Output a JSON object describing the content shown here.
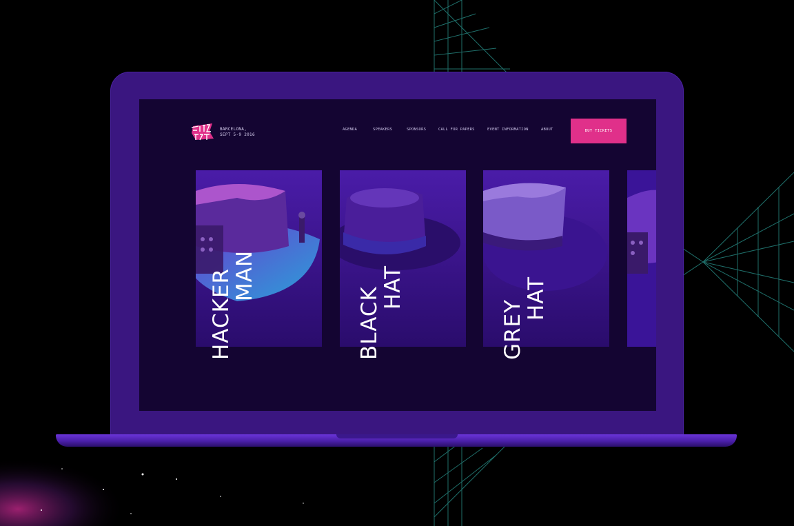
{
  "nav": {
    "logo_alt": "Full Stack Fest",
    "location_line1": "BARCELONA,",
    "location_line2": "SEPT 5-9 2016",
    "menu": [
      {
        "label": "AGENDA"
      },
      {
        "label": "SPEAKERS"
      },
      {
        "label": "SPONSORS"
      },
      {
        "label": "CALL FOR PAPERS"
      },
      {
        "label": "EVENT INFORMATION"
      },
      {
        "label": "ABOUT"
      }
    ],
    "cta_label": "BUY TICKETS"
  },
  "cards": [
    {
      "line1": "HACKER",
      "line2": "MAN",
      "icon": "hacker-hat-icon"
    },
    {
      "line1": "BLACK",
      "line2": "HAT",
      "icon": "fedora-hat-icon"
    },
    {
      "line1": "GREY",
      "line2": "HAT",
      "icon": "grey-hat-icon"
    }
  ],
  "colors": {
    "background": "#000000",
    "laptop": "#3a1680",
    "screen": "#140532",
    "accent": "#e0308a"
  }
}
